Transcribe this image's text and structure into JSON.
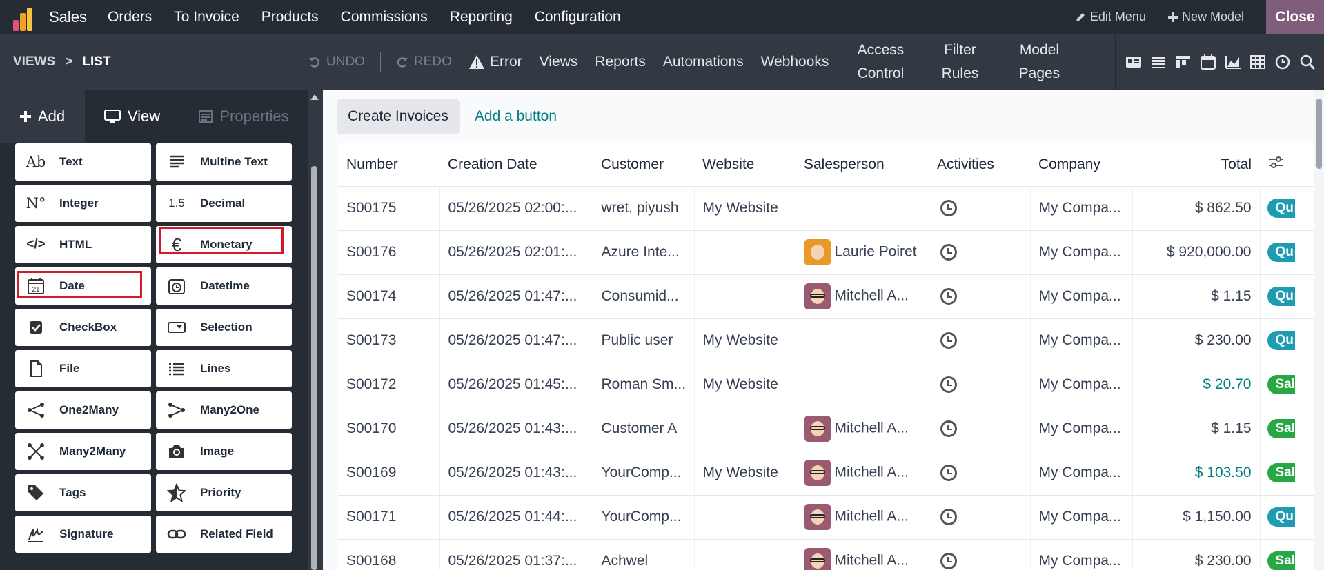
{
  "navbar": {
    "app": "Sales",
    "menu": [
      "Orders",
      "To Invoice",
      "Products",
      "Commissions",
      "Reporting",
      "Configuration"
    ],
    "edit_menu": "Edit Menu",
    "new_model": "New Model",
    "close": "Close"
  },
  "subbar": {
    "breadcrumb_root": "VIEWS",
    "breadcrumb_sep": ">",
    "breadcrumb_current": "LIST",
    "undo": "UNDO",
    "redo": "REDO",
    "error": "Error",
    "views": "Views",
    "reports": "Reports",
    "automations": "Automations",
    "webhooks": "Webhooks",
    "access_1": "Access",
    "access_2": "Control",
    "filter_1": "Filter",
    "filter_2": "Rules",
    "model_1": "Model",
    "model_2": "Pages"
  },
  "sidebar": {
    "tab_add": "Add",
    "tab_view": "View",
    "tab_properties": "Properties",
    "fields": [
      {
        "label": "Text",
        "icon": "text-ab-icon"
      },
      {
        "label": "Multine Text",
        "icon": "multiline-text-icon"
      },
      {
        "label": "Integer",
        "icon": "integer-icon"
      },
      {
        "label": "Decimal",
        "icon": "decimal-icon"
      },
      {
        "label": "HTML",
        "icon": "html-code-icon"
      },
      {
        "label": "Monetary",
        "icon": "euro-icon"
      },
      {
        "label": "Date",
        "icon": "calendar-icon"
      },
      {
        "label": "Datetime",
        "icon": "clock-calendar-icon"
      },
      {
        "label": "CheckBox",
        "icon": "checkbox-icon"
      },
      {
        "label": "Selection",
        "icon": "selection-icon"
      },
      {
        "label": "File",
        "icon": "file-icon"
      },
      {
        "label": "Lines",
        "icon": "list-lines-icon"
      },
      {
        "label": "One2Many",
        "icon": "one2many-icon"
      },
      {
        "label": "Many2One",
        "icon": "many2one-icon"
      },
      {
        "label": "Many2Many",
        "icon": "many2many-icon"
      },
      {
        "label": "Image",
        "icon": "camera-icon"
      },
      {
        "label": "Tags",
        "icon": "tag-icon"
      },
      {
        "label": "Priority",
        "icon": "star-icon"
      },
      {
        "label": "Signature",
        "icon": "signature-icon"
      },
      {
        "label": "Related Field",
        "icon": "link-icon"
      }
    ],
    "icon_glyphs": {
      "text": "Ab",
      "integer": "N°",
      "decimal": "1.5",
      "html": "</>",
      "monetary": "€",
      "date": "21"
    }
  },
  "main": {
    "create_invoices": "Create Invoices",
    "add_button": "Add a button",
    "columns": [
      "Number",
      "Creation Date",
      "Customer",
      "Website",
      "Salesperson",
      "Activities",
      "Company",
      "Total"
    ],
    "rows": [
      {
        "number": "S00175",
        "date": "05/26/2025 02:00:...",
        "customer": "wret, piyush",
        "website": "My Website",
        "salesperson": "",
        "avatar": "",
        "company": "My Compa...",
        "total": "$ 862.50",
        "total_color": "default",
        "status": "Qu",
        "status_kind": "q"
      },
      {
        "number": "S00176",
        "date": "05/26/2025 02:01:...",
        "customer": "Azure Inte...",
        "website": "",
        "salesperson": "Laurie Poiret",
        "avatar": "laurie",
        "company": "My Compa...",
        "total": "$ 920,000.00",
        "total_color": "default",
        "status": "Qu",
        "status_kind": "q"
      },
      {
        "number": "S00174",
        "date": "05/26/2025 01:47:...",
        "customer": "Consumid...",
        "website": "",
        "salesperson": "Mitchell A...",
        "avatar": "mitchell",
        "company": "My Compa...",
        "total": "$ 1.15",
        "total_color": "default",
        "status": "Qu",
        "status_kind": "q"
      },
      {
        "number": "S00173",
        "date": "05/26/2025 01:47:...",
        "customer": "Public user",
        "website": "My Website",
        "salesperson": "",
        "avatar": "",
        "company": "My Compa...",
        "total": "$ 230.00",
        "total_color": "default",
        "status": "Qu",
        "status_kind": "q"
      },
      {
        "number": "S00172",
        "date": "05/26/2025 01:45:...",
        "customer": "Roman Sm...",
        "website": "My Website",
        "salesperson": "",
        "avatar": "",
        "company": "My Compa...",
        "total": "$ 20.70",
        "total_color": "blue",
        "status": "Sal",
        "status_kind": "s"
      },
      {
        "number": "S00170",
        "date": "05/26/2025 01:43:...",
        "customer": "Customer A",
        "website": "",
        "salesperson": "Mitchell A...",
        "avatar": "mitchell",
        "company": "My Compa...",
        "total": "$ 1.15",
        "total_color": "default",
        "status": "Sal",
        "status_kind": "s"
      },
      {
        "number": "S00169",
        "date": "05/26/2025 01:43:...",
        "customer": "YourComp...",
        "website": "My Website",
        "salesperson": "Mitchell A...",
        "avatar": "mitchell",
        "company": "My Compa...",
        "total": "$ 103.50",
        "total_color": "blue",
        "status": "Sal",
        "status_kind": "s"
      },
      {
        "number": "S00171",
        "date": "05/26/2025 01:44:...",
        "customer": "YourComp...",
        "website": "",
        "salesperson": "Mitchell A...",
        "avatar": "mitchell",
        "company": "My Compa...",
        "total": "$ 1,150.00",
        "total_color": "default",
        "status": "Qu",
        "status_kind": "q"
      },
      {
        "number": "S00168",
        "date": "05/26/2025 01:37:...",
        "customer": "Achwel",
        "website": "",
        "salesperson": "Mitchell A...",
        "avatar": "mitchell",
        "company": "My Compa...",
        "total": "$ 230.00",
        "total_color": "default",
        "status": "Sal",
        "status_kind": "s"
      }
    ]
  },
  "colors": {
    "navbar": "#262c34",
    "subbar": "#323943",
    "accent": "#017e84",
    "close": "#7f5d7b",
    "highlight": "#d11a2a",
    "quotation": "#1e9db2",
    "sales": "#28a745"
  }
}
